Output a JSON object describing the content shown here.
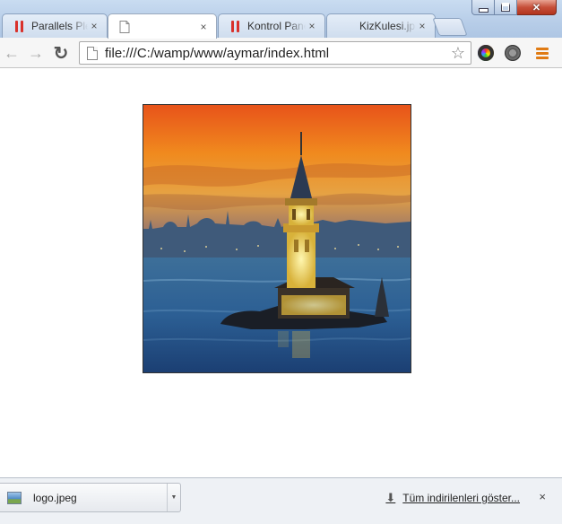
{
  "tabs": [
    {
      "label": "Parallels Plesk",
      "icon": "parallels-icon",
      "active": false
    },
    {
      "label": "",
      "icon": "blank-page-icon",
      "active": true
    },
    {
      "label": "Kontrol Paneli",
      "icon": "parallels-icon",
      "active": false
    },
    {
      "label": "KizKulesi.jpeg",
      "icon": "image-icon",
      "active": false
    }
  ],
  "tab_close_glyph": "×",
  "toolbar": {
    "back_glyph": "←",
    "forward_glyph": "→",
    "reload_glyph": "↻",
    "address": "file:///C:/wamp/www/aymar/index.html",
    "star_glyph": "☆"
  },
  "content": {
    "image": "maidens-tower-istanbul-photo"
  },
  "downloads": {
    "file_name": "logo.jpeg",
    "dropdown_glyph": "▼",
    "show_all": "Tüm indirilenleri göster...",
    "show_all_icon_glyph": "⬇",
    "close_glyph": "×"
  },
  "window_controls": {
    "close_glyph": "✕"
  },
  "colors": {
    "tab_strip": "#b7cde8",
    "parallels_red": "#d9312b",
    "menu_orange": "#e07b14",
    "link": "#222222"
  }
}
